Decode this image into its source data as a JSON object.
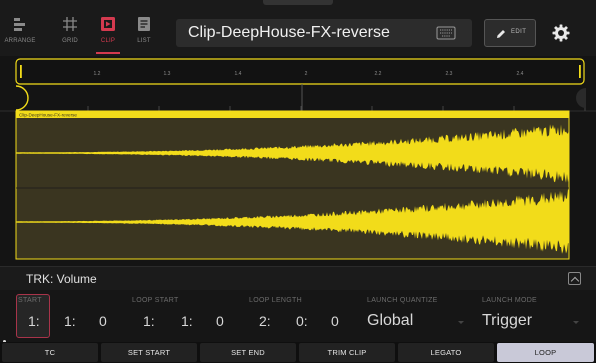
{
  "modes": [
    {
      "label": "ARRANGE",
      "icon": "arrange-icon",
      "active": false
    },
    {
      "label": "GRID",
      "icon": "grid-icon",
      "active": false
    },
    {
      "label": "CLIP",
      "icon": "clip-icon",
      "active": true
    },
    {
      "label": "LIST",
      "icon": "list-icon",
      "active": false
    }
  ],
  "clip_name": "Clip-DeepHouse-FX-reverse",
  "edit_label": "EDIT",
  "timeline": {
    "ticks": [
      "1.2",
      "1.3",
      "1.4",
      "2",
      "2.2",
      "2.3",
      "2.4"
    ]
  },
  "clip_label": "Clip-DeepHouse-FX-reverse",
  "track_param": "TRK: Volume",
  "params": {
    "start_label": "START",
    "start_values": [
      "1:",
      "1:",
      "0"
    ],
    "loop_start_label": "LOOP START",
    "loop_start_values": [
      "1:",
      "1:",
      "0"
    ],
    "loop_length_label": "LOOP LENGTH",
    "loop_length_values": [
      "2:",
      "0:",
      "0"
    ],
    "launch_quantize_label": "LAUNCH QUANTIZE",
    "launch_quantize_value": "Global",
    "launch_mode_label": "LAUNCH MODE",
    "launch_mode_value": "Trigger"
  },
  "buttons": [
    {
      "label": "TC",
      "on": false
    },
    {
      "label": "SET START",
      "on": false
    },
    {
      "label": "SET END",
      "on": false
    },
    {
      "label": "TRIM CLIP",
      "on": false
    },
    {
      "label": "LEGATO",
      "on": false
    },
    {
      "label": "LOOP",
      "on": true
    }
  ],
  "colors": {
    "accent": "#d43a4f",
    "waveform": "#f2dc1a",
    "clip_bg": "#3a3520"
  }
}
